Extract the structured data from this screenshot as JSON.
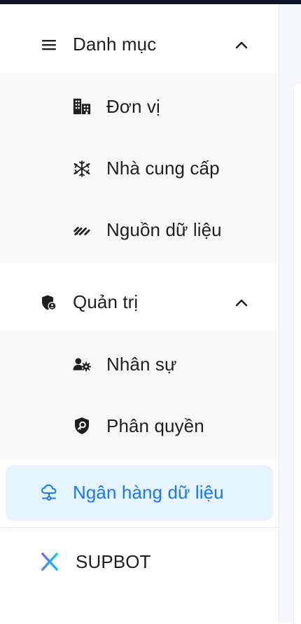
{
  "menu": {
    "category": {
      "label": "Danh mục",
      "items": [
        {
          "label": "Đơn vị",
          "icon": "building-icon"
        },
        {
          "label": "Nhà cung cấp",
          "icon": "snowflake-icon"
        },
        {
          "label": "Nguồn dữ liệu",
          "icon": "data-source-icon"
        }
      ]
    },
    "admin": {
      "label": "Quản trị",
      "items": [
        {
          "label": "Nhân sự",
          "icon": "user-settings-icon"
        },
        {
          "label": "Phân quyền",
          "icon": "shield-key-icon"
        }
      ]
    },
    "data_bank": {
      "label": "Ngân hàng dữ liệu",
      "icon": "cloud-network-icon",
      "active": true
    },
    "supbot": {
      "label": "SUPBOT",
      "icon": "supbot-logo-icon"
    }
  },
  "colors": {
    "accent": "#1677ff",
    "active_bg": "#e6f4ff",
    "group_bg": "#f8f8f8",
    "topbar": "#0c1526"
  }
}
